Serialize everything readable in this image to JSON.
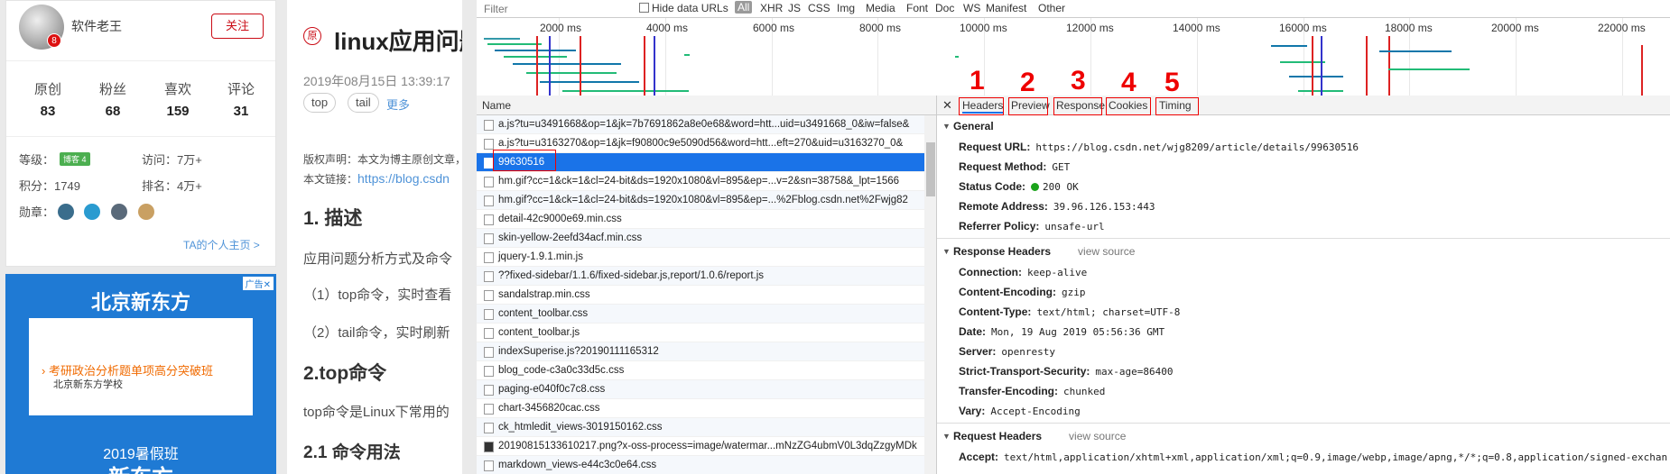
{
  "profile": {
    "name": "软件老王",
    "avatar_badge": "8",
    "follow_label": "关注",
    "stats": [
      {
        "label": "原创",
        "value": "83"
      },
      {
        "label": "粉丝",
        "value": "68"
      },
      {
        "label": "喜欢",
        "value": "159"
      },
      {
        "label": "评论",
        "value": "31"
      }
    ],
    "level_label": "等级：",
    "level_badge": "博客 4",
    "visits_label": "访问：",
    "visits_value": "7万+",
    "points_label": "积分：",
    "points_value": "1749",
    "rank_label": "排名：",
    "rank_value": "4万+",
    "medals_label": "勋章：",
    "ta_link": "TA的个人主页 >"
  },
  "ad": {
    "close_label": "广告✕",
    "title": "北京新东方",
    "line1": "考研政治分析题单项高分突破班",
    "line2": "北京新东方学校",
    "foot1": "2019暑假班",
    "foot2": "新东方"
  },
  "article": {
    "tag": "原",
    "title": "linux应用问题",
    "date": "2019年08月15日 13:39:17",
    "tags": [
      "top",
      "tail"
    ],
    "more": "更多",
    "copyright": "版权声明：本文为博主原创文章，",
    "link_label": "本文链接：",
    "link_url": "https://blog.csdn",
    "h1": "1. 描述",
    "p1": "应用问题分析方式及命令",
    "p2": "（1）top命令，实时查看",
    "p3": "（2）tail命令，实时刷新",
    "h2": "2.top命令",
    "p4": "top命令是Linux下常用的",
    "h3": "2.1 命令用法"
  },
  "devtools": {
    "filter_placeholder": "Filter",
    "hide_data_urls": "Hide data URLs",
    "all": "All",
    "types": [
      "XHR",
      "JS",
      "CSS",
      "Img",
      "Media",
      "Font",
      "Doc",
      "WS",
      "Manifest",
      "Other"
    ],
    "timeline_ticks": [
      "2000 ms",
      "4000 ms",
      "6000 ms",
      "8000 ms",
      "10000 ms",
      "12000 ms",
      "14000 ms",
      "16000 ms",
      "18000 ms",
      "20000 ms",
      "22000 ms"
    ],
    "name_header": "Name",
    "requests": [
      "a.js?tu=u3491668&op=1&jk=7b7691862a8e0e68&word=htt...uid=u3491668_0&iw=false&",
      "a.js?tu=u3163270&op=1&jk=f90800c9e5090d56&word=htt...eft=270&uid=u3163270_0&",
      "99630516",
      "hm.gif?cc=1&ck=1&cl=24-bit&ds=1920x1080&vl=895&ep=...v=2&sn=38758&_lpt=1566",
      "hm.gif?cc=1&ck=1&cl=24-bit&ds=1920x1080&vl=895&ep=...%2Fblog.csdn.net%2Fwjg82",
      "detail-42c9000e69.min.css",
      "skin-yellow-2eefd34acf.min.css",
      "jquery-1.9.1.min.js",
      "??fixed-sidebar/1.1.6/fixed-sidebar.js,report/1.0.6/report.js",
      "sandalstrap.min.css",
      "content_toolbar.css",
      "content_toolbar.js",
      "indexSuperise.js?20190111165312",
      "blog_code-c3a0c33d5c.css",
      "paging-e040f0c7c8.css",
      "chart-3456820cac.css",
      "ck_htmledit_views-3019150162.css",
      "20190815133610217.png?x-oss-process=image/watermar...mNzZG4ubmV0L3dqZzgyMDk",
      "markdown_views-e44c3c0e64.css"
    ],
    "selected_index": 2,
    "tabs": [
      "Headers",
      "Preview",
      "Response",
      "Cookies",
      "Timing"
    ],
    "annotation_numbers": [
      "1",
      "2",
      "3",
      "4",
      "5"
    ],
    "general": {
      "title": "General",
      "items": [
        {
          "k": "Request URL:",
          "v": "https://blog.csdn.net/wjg8209/article/details/99630516"
        },
        {
          "k": "Request Method:",
          "v": "GET"
        },
        {
          "k": "Status Code:",
          "v": "200 OK"
        },
        {
          "k": "Remote Address:",
          "v": "39.96.126.153:443"
        },
        {
          "k": "Referrer Policy:",
          "v": "unsafe-url"
        }
      ]
    },
    "response_headers": {
      "title": "Response Headers",
      "view_source": "view source",
      "items": [
        {
          "k": "Connection:",
          "v": "keep-alive"
        },
        {
          "k": "Content-Encoding:",
          "v": "gzip"
        },
        {
          "k": "Content-Type:",
          "v": "text/html; charset=UTF-8"
        },
        {
          "k": "Date:",
          "v": "Mon, 19 Aug 2019 05:56:36 GMT"
        },
        {
          "k": "Server:",
          "v": "openresty"
        },
        {
          "k": "Strict-Transport-Security:",
          "v": "max-age=86400"
        },
        {
          "k": "Transfer-Encoding:",
          "v": "chunked"
        },
        {
          "k": "Vary:",
          "v": "Accept-Encoding"
        }
      ]
    },
    "request_headers": {
      "title": "Request Headers",
      "view_source": "view source",
      "items": [
        {
          "k": "Accept:",
          "v": "text/html,application/xhtml+xml,application/xml;q=0.9,image/webp,image/apng,*/*;q=0.8,application/signed-exchan"
        }
      ]
    }
  }
}
